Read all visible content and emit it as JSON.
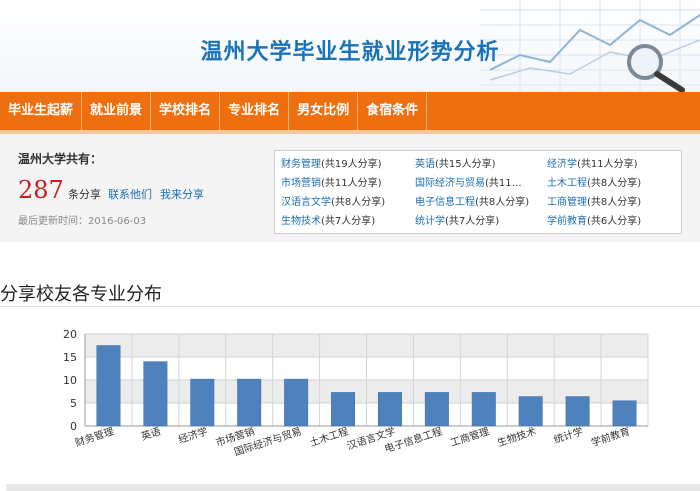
{
  "header": {
    "title": "温州大学毕业生就业形势分析"
  },
  "nav": {
    "items": [
      {
        "label": "毕业生起薪"
      },
      {
        "label": "就业前景"
      },
      {
        "label": "学校排名"
      },
      {
        "label": "专业排名"
      },
      {
        "label": "男女比例"
      },
      {
        "label": "食宿条件"
      }
    ]
  },
  "summary": {
    "label": "温州大学共有：",
    "count": "287",
    "unit": "条分享",
    "contact_link": "联系他们",
    "share_link": "我来分享",
    "updated_label": "最后更新时间：",
    "updated_date": "2016-06-03"
  },
  "majors": [
    {
      "name": "财务管理",
      "count": "(共19人分享)"
    },
    {
      "name": "英语",
      "count": "(共15人分享)"
    },
    {
      "name": "经济学",
      "count": "(共11人分享)"
    },
    {
      "name": "市场营销",
      "count": "(共11人分享)"
    },
    {
      "name": "国际经济与贸易",
      "count": "(共11…"
    },
    {
      "name": "土木工程",
      "count": "(共8人分享)"
    },
    {
      "name": "汉语言文学",
      "count": "(共8人分享)"
    },
    {
      "name": "电子信息工程",
      "count": "(共8人分享)"
    },
    {
      "name": "工商管理",
      "count": "(共8人分享)"
    },
    {
      "name": "生物技术",
      "count": "(共7人分享)"
    },
    {
      "name": "统计学",
      "count": "(共7人分享)"
    },
    {
      "name": "学前教育",
      "count": "(共6人分享)"
    }
  ],
  "section": {
    "title": "分享校友各专业分布"
  },
  "colors": {
    "nav": "#ee6f10",
    "bar": "#4f81bd",
    "link": "#1a6fb3",
    "count": "#c81e1e"
  },
  "chart_data": {
    "type": "bar",
    "categories": [
      "财务管理",
      "英语",
      "经济学",
      "市场营销",
      "国际经济与贸易",
      "土木工程",
      "汉语言文学",
      "电子信息工程",
      "工商管理",
      "生物技术",
      "统计学",
      "学前教育"
    ],
    "values": [
      17.5,
      14,
      10.2,
      10.2,
      10.2,
      7.3,
      7.3,
      7.3,
      7.3,
      6.4,
      6.4,
      5.5
    ],
    "yticks": [
      0,
      5,
      10,
      15,
      20
    ],
    "ylim": [
      0,
      20
    ],
    "grid": true,
    "title": "",
    "xlabel": "",
    "ylabel": ""
  }
}
